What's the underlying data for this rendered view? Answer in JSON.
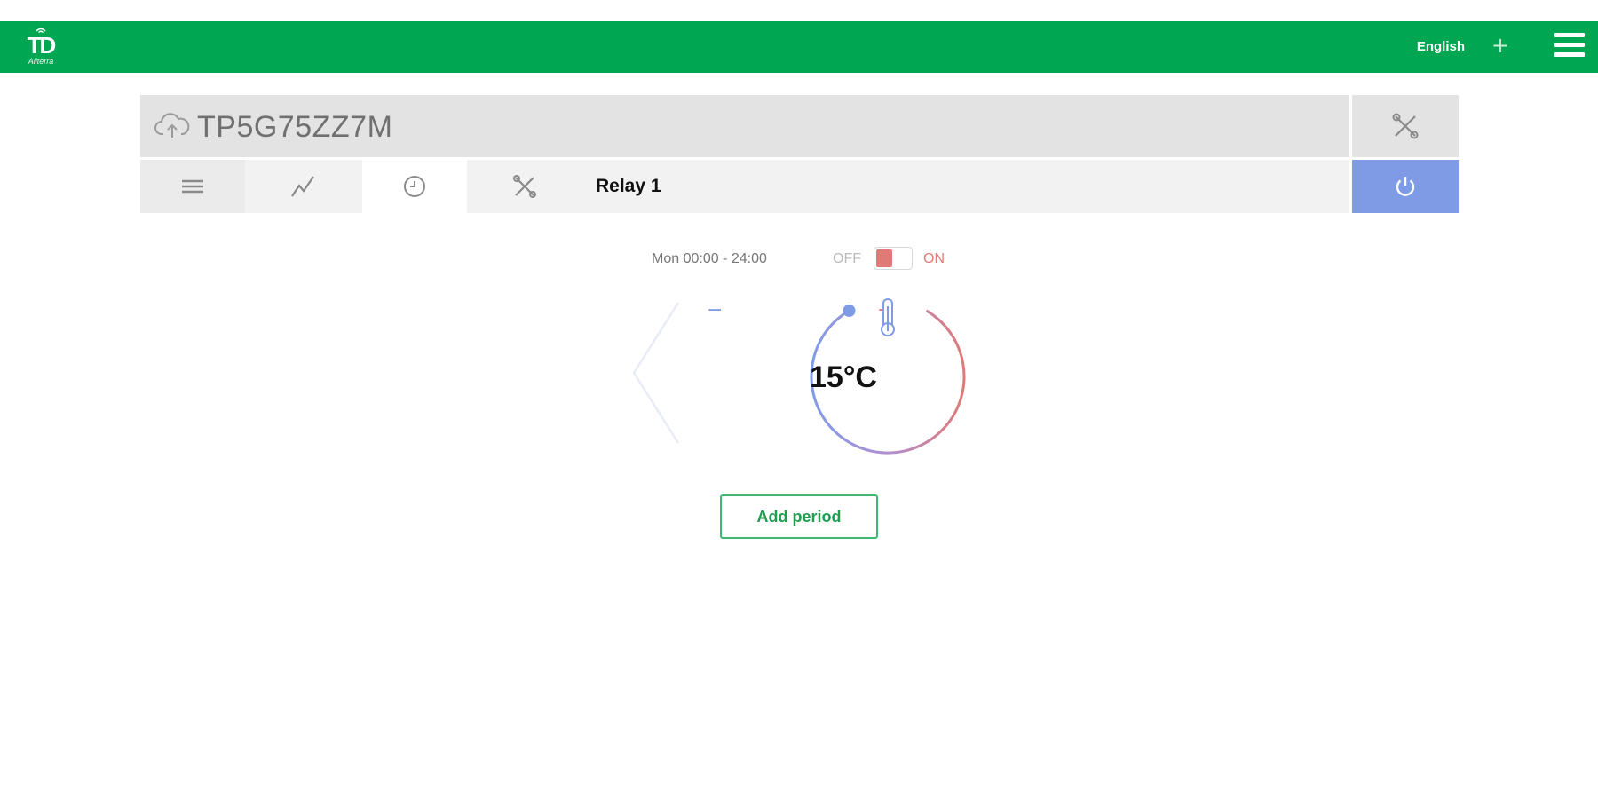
{
  "header": {
    "logo_text": "TD",
    "logo_subtext": "Allterra",
    "language": "English",
    "add_symbol": "+"
  },
  "device": {
    "name": "TP5G75ZZ7M"
  },
  "tabs": [
    {
      "icon": "list-icon"
    },
    {
      "icon": "chart-icon"
    },
    {
      "icon": "clock-icon"
    },
    {
      "icon": "tools-icon"
    }
  ],
  "relay": {
    "label": "Relay 1"
  },
  "schedule": {
    "period": "Mon 00:00 - 24:00",
    "off_label": "OFF",
    "on_label": "ON",
    "toggle_state": "off"
  },
  "thermostat": {
    "temperature": "15°C",
    "minus": "−",
    "plus": "+"
  },
  "actions": {
    "add_period": "Add period"
  },
  "colors": {
    "header": "#00a651",
    "power": "#7f9be6",
    "cold": "#7f9be6",
    "hot": "#e07a76",
    "button_border": "#3dba70"
  }
}
